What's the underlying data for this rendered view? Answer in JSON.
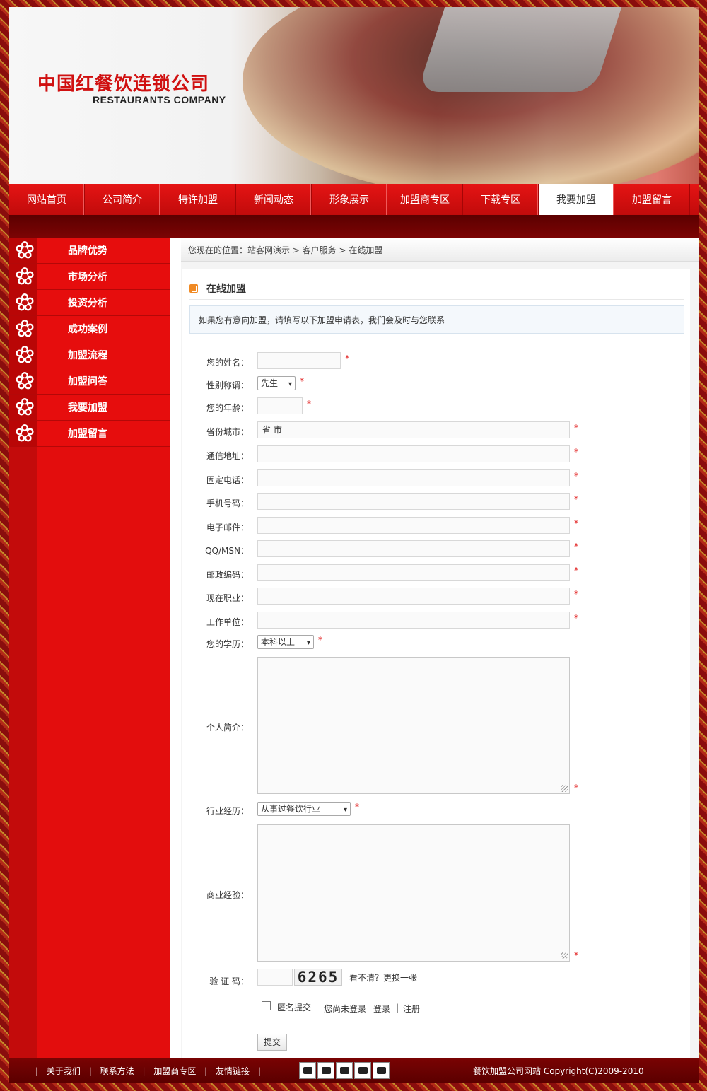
{
  "header": {
    "logo_cn": "中国红餐饮连锁公司",
    "logo_en": "RESTAURANTS COMPANY"
  },
  "nav": {
    "items": [
      "网站首页",
      "公司简介",
      "特许加盟",
      "新闻动态",
      "形象展示",
      "加盟商专区",
      "下载专区",
      "我要加盟",
      "加盟留言"
    ],
    "active": "我要加盟"
  },
  "sidebar": {
    "items": [
      "品牌优势",
      "市场分析",
      "投资分析",
      "成功案例",
      "加盟流程",
      "加盟问答",
      "我要加盟",
      "加盟留言"
    ]
  },
  "breadcrumb": "您现在的位置：站客网演示 > 客户服务 > 在线加盟",
  "section_title": "在线加盟",
  "notice": "如果您有意向加盟，请填写以下加盟申请表，我们会及时与您联系",
  "form": {
    "required_mark": "*",
    "name_label": "您的姓名：",
    "gender_label": "性别称谓：",
    "gender_value": "先生",
    "age_label": "您的年龄：",
    "city_label": "省份城市：",
    "city_value": "省  市",
    "address_label": "通信地址：",
    "phone_label": "固定电话：",
    "mobile_label": "手机号码：",
    "email_label": "电子邮件：",
    "qq_label": "QQ/MSN：",
    "zip_label": "邮政编码：",
    "job_label": "现在职业：",
    "company_label": "工作单位：",
    "edu_label": "您的学历：",
    "edu_value": "本科以上",
    "intro_label": "个人简介：",
    "industry_label": "行业经历：",
    "industry_value": "从事过餐饮行业",
    "biz_label": "商业经验：",
    "captcha_label": "验 证 码：",
    "captcha_code": "6265",
    "captcha_refresh": "看不清？更换一张",
    "anon_label": "匿名提交",
    "not_logged": "您尚未登录",
    "login": "登录",
    "sep": "|",
    "register": "注册",
    "submit": "提交"
  },
  "footer": {
    "links": [
      "关于我们",
      "联系方法",
      "加盟商专区",
      "友情链接"
    ],
    "sep": "|",
    "copyright": "餐饮加盟公司网站 Copyright(C)2009-2010"
  },
  "colors": {
    "primary_red": "#e30d0d",
    "dark_red": "#5c0000",
    "required": "#e21c1c"
  }
}
